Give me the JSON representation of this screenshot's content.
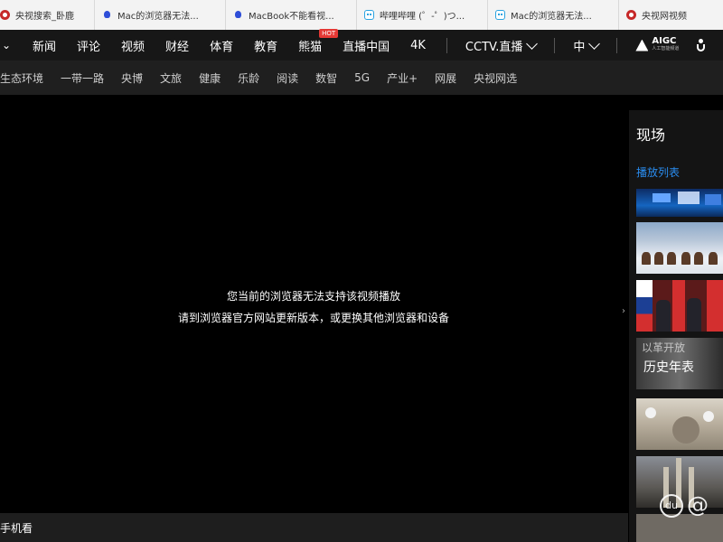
{
  "browser": {
    "tabs": [
      {
        "icon": "cctv-icon",
        "label": "央视搜索_卧鹿"
      },
      {
        "icon": "baidu-icon",
        "label": "Mac的浏览器无法..."
      },
      {
        "icon": "baidu-icon",
        "label": "MacBook不能看视..."
      },
      {
        "icon": "bilibili-icon",
        "label": "哔哩哔哩 (゜-゜)つ..."
      },
      {
        "icon": "bilibili-icon",
        "label": "Mac的浏览器无法..."
      },
      {
        "icon": "cctv-icon",
        "label": "央视网视频"
      }
    ]
  },
  "nav": {
    "items": [
      "新闻",
      "评论",
      "视频",
      "财经",
      "体育",
      "教育",
      "熊猫",
      "直播中国",
      "4K"
    ],
    "hot_badge": "HOT",
    "cctv_live": "CCTV.直播",
    "lang": "中",
    "aigc": "AIGC",
    "aigc_sub": "人工智能频道"
  },
  "subnav": {
    "items": [
      "生态环境",
      "一带一路",
      "央博",
      "文旅",
      "健康",
      "乐龄",
      "阅读",
      "数智",
      "5G",
      "产业+",
      "网展",
      "央视网选"
    ]
  },
  "player": {
    "message_line1": "您当前的浏览器无法支持该视频播放",
    "message_line2": "请到浏览器官方网站更新版本，或更换其他浏览器和设备"
  },
  "bottombar": {
    "text": "手机看"
  },
  "sidebar": {
    "title": "现场",
    "tab": "播放列表",
    "thumb_caption": "以革开放",
    "thumb_caption2": "历史年表"
  },
  "watermark": {
    "text": "@",
    "logo": "du"
  },
  "colors": {
    "accent_blue": "#2a8df0",
    "hot_red": "#e53935"
  }
}
